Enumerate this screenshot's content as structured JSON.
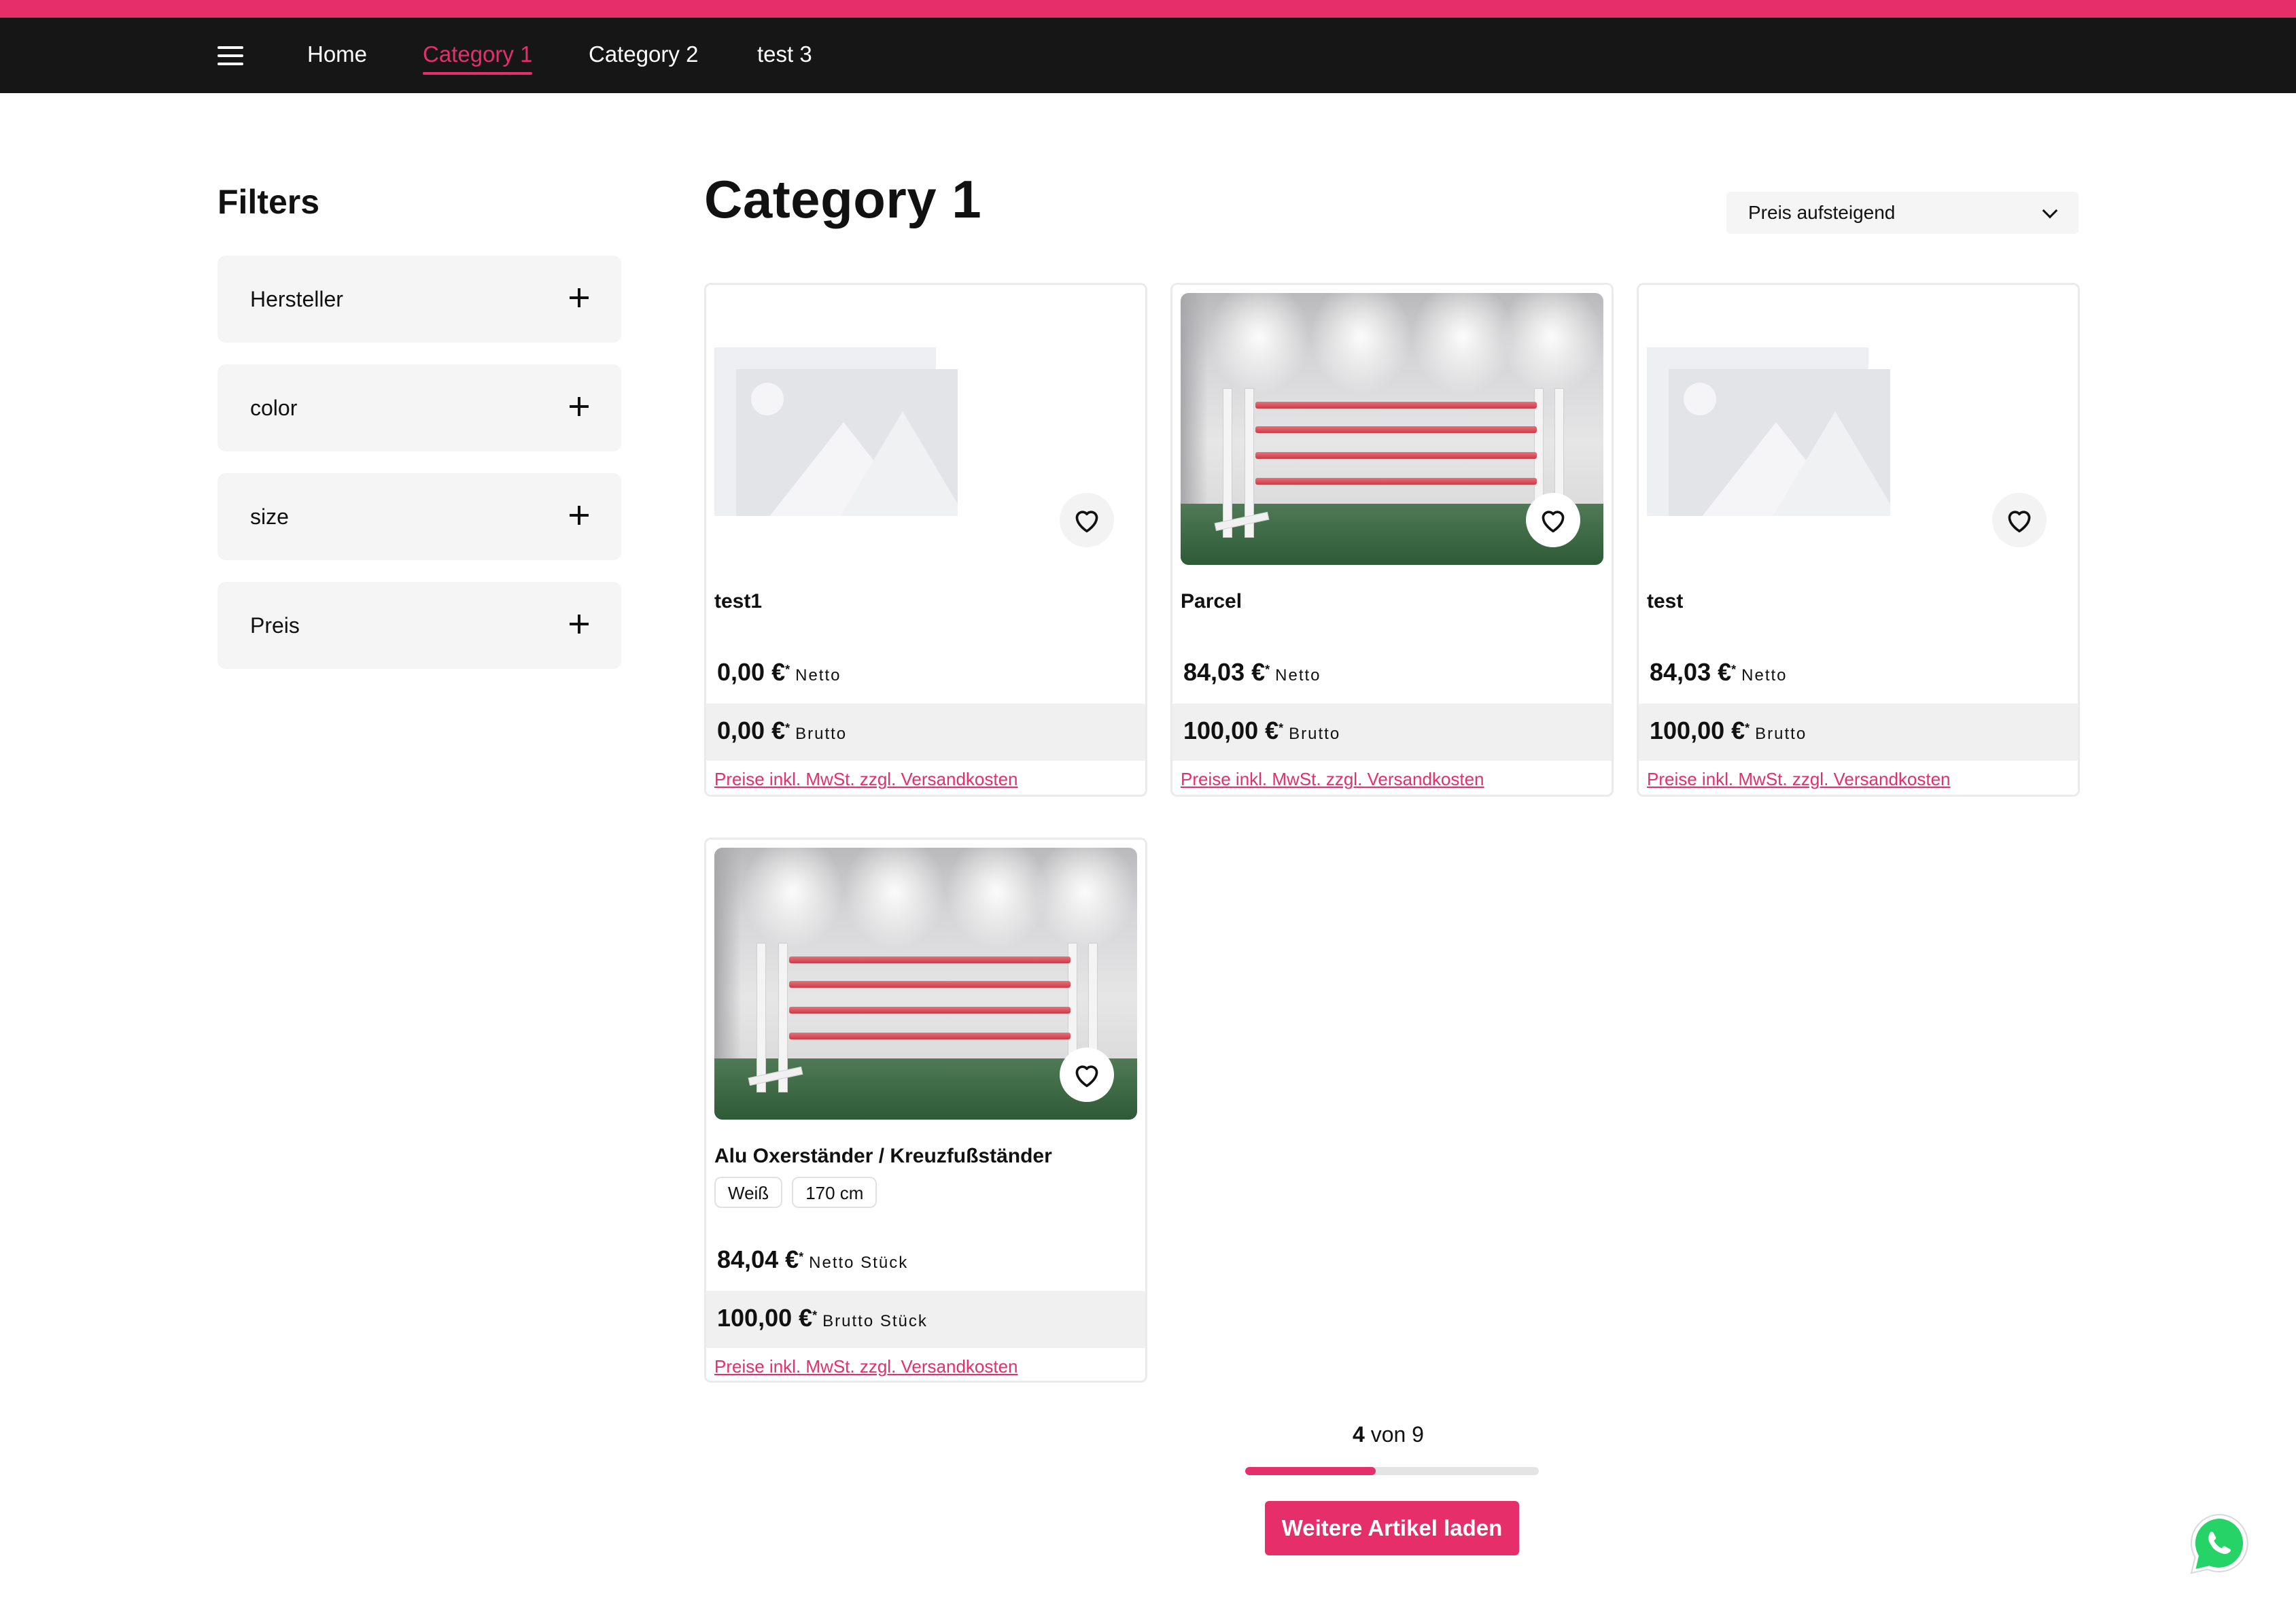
{
  "header": {
    "menu_icon": "hamburger-menu-icon",
    "nav": [
      {
        "label": "Home",
        "active": false
      },
      {
        "label": "Category 1",
        "active": true
      },
      {
        "label": "Category 2",
        "active": false
      },
      {
        "label": "test 3",
        "active": false
      }
    ],
    "accent_color": "#e62e6b",
    "bar_color": "#161616"
  },
  "sidebar": {
    "title": "Filters",
    "filters": [
      {
        "label": "Hersteller",
        "icon": "plus-icon"
      },
      {
        "label": "color",
        "icon": "plus-icon"
      },
      {
        "label": "size",
        "icon": "plus-icon"
      },
      {
        "label": "Preis",
        "icon": "plus-icon"
      }
    ]
  },
  "main": {
    "title": "Category 1",
    "sort": {
      "selected": "Preis aufsteigend",
      "icon": "chevron-down-icon"
    },
    "products": [
      {
        "name": "test1",
        "image": "placeholder-image",
        "options": [],
        "net_price": "0,00 €",
        "net_suffix": "*",
        "net_label": "Netto",
        "gross_price": "0,00 €",
        "gross_suffix": "*",
        "gross_label": "Brutto",
        "tax_note": "Preise inkl. MwSt. zzgl. Versandkosten",
        "wishlist_icon": "heart-icon"
      },
      {
        "name": "Parcel",
        "image": "jump-stand-photo",
        "options": [],
        "net_price": "84,03 €",
        "net_suffix": "*",
        "net_label": "Netto",
        "gross_price": "100,00 €",
        "gross_suffix": "*",
        "gross_label": "Brutto",
        "tax_note": "Preise inkl. MwSt. zzgl. Versandkosten",
        "wishlist_icon": "heart-icon"
      },
      {
        "name": "test",
        "image": "placeholder-image",
        "options": [],
        "net_price": "84,03 €",
        "net_suffix": "*",
        "net_label": "Netto",
        "gross_price": "100,00 €",
        "gross_suffix": "*",
        "gross_label": "Brutto",
        "tax_note": "Preise inkl. MwSt. zzgl. Versandkosten",
        "wishlist_icon": "heart-icon"
      },
      {
        "name": "Alu Oxerständer / Kreuzfußständer",
        "image": "jump-stand-photo",
        "options": [
          "Weiß",
          "170 cm"
        ],
        "net_price": "84,04 €",
        "net_suffix": "*",
        "net_label": "Netto Stück",
        "gross_price": "100,00 €",
        "gross_suffix": "*",
        "gross_label": "Brutto Stück",
        "tax_note": "Preise inkl. MwSt. zzgl. Versandkosten",
        "wishlist_icon": "heart-icon"
      }
    ]
  },
  "pagination": {
    "shown": "4",
    "separator": "von",
    "total": "9",
    "progress_fraction": 0.444,
    "load_more_label": "Weitere Artikel laden"
  },
  "whatsapp": {
    "icon": "whatsapp-icon",
    "color": "#25d366"
  }
}
